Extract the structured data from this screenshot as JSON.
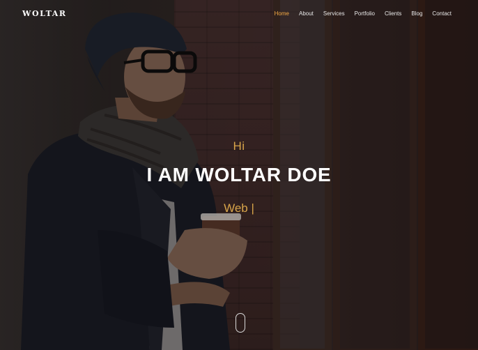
{
  "nav": {
    "logo": "WOLTAR",
    "items": [
      {
        "label": "Home",
        "active": true
      },
      {
        "label": "About",
        "active": false
      },
      {
        "label": "Services",
        "active": false
      },
      {
        "label": "Portfolio",
        "active": false
      },
      {
        "label": "Clients",
        "active": false
      },
      {
        "label": "Blog",
        "active": false
      },
      {
        "label": "Contact",
        "active": false
      }
    ]
  },
  "hero": {
    "greeting": "Hi",
    "name": "I AM WOLTAR DOE",
    "typed_text": "Web |"
  },
  "colors": {
    "accent": "#d9a54a",
    "nav_active": "#f4a944",
    "text_light": "#ffffff"
  },
  "icons": {
    "scroll": "mouse-scroll-icon"
  }
}
